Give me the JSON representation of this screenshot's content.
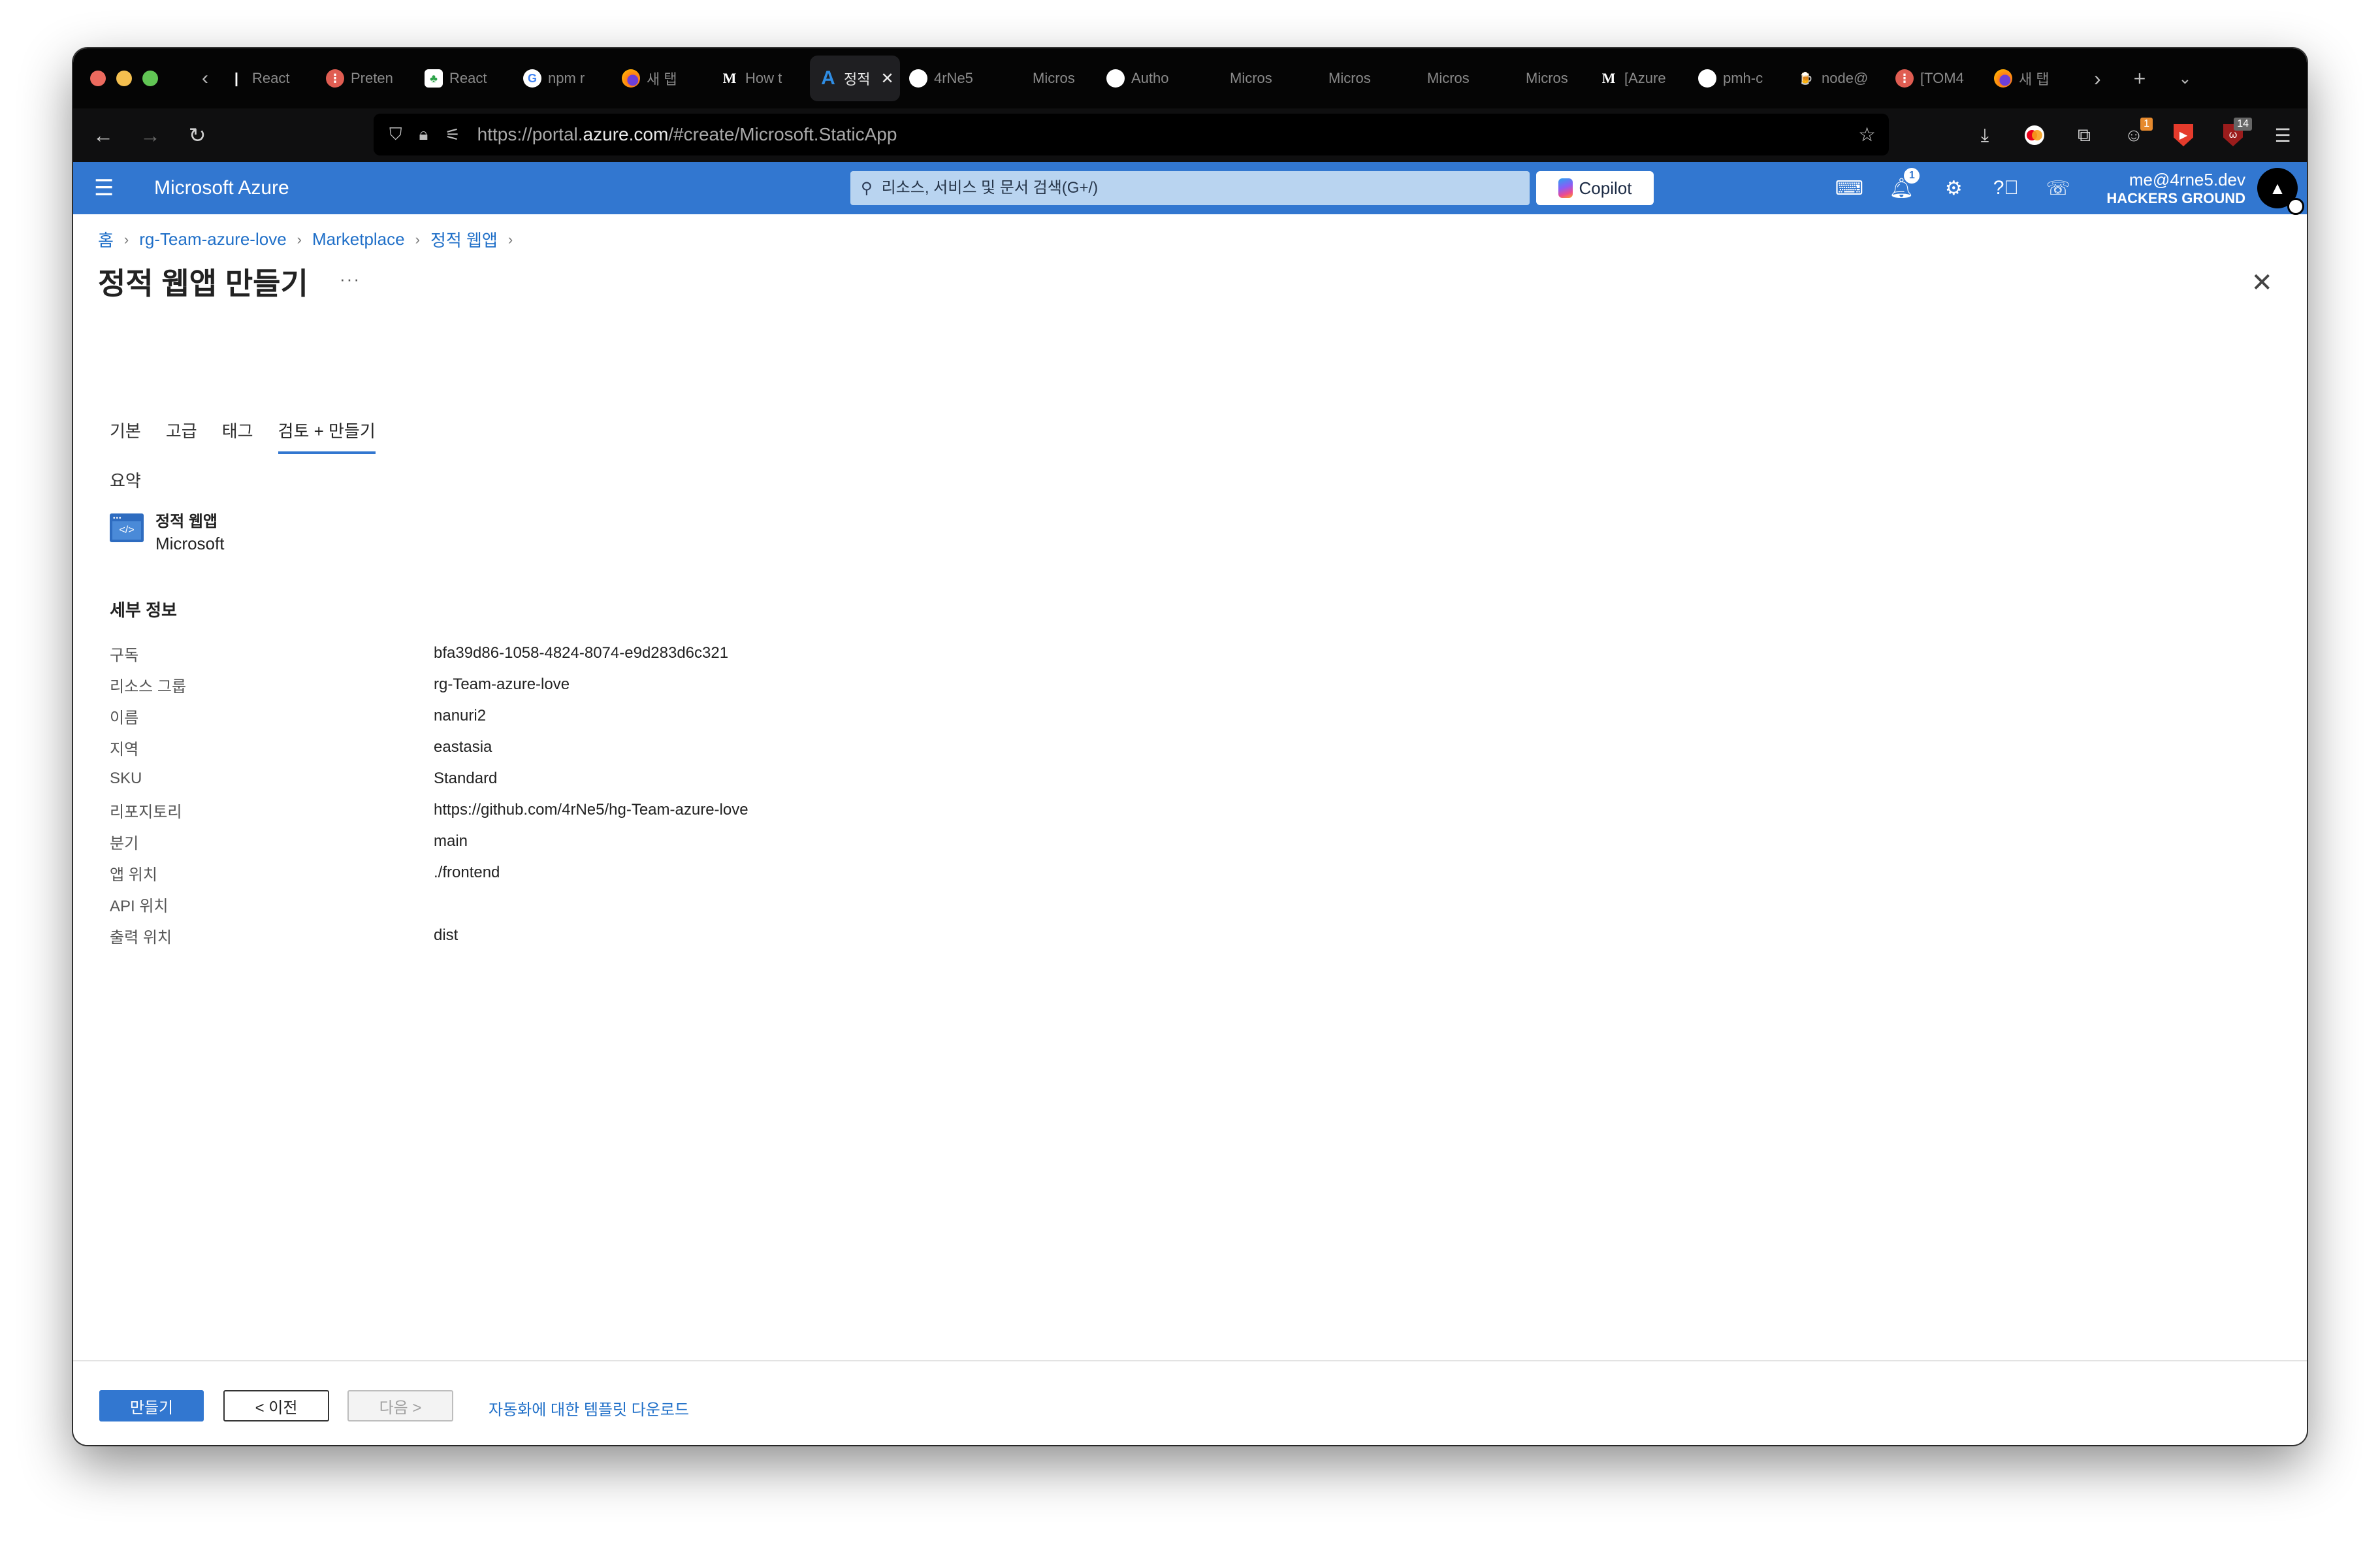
{
  "browser": {
    "tabs": [
      {
        "icon": "react-icon",
        "title": "React",
        "active": false
      },
      {
        "icon": "toggl-icon",
        "title": "Preten",
        "active": false
      },
      {
        "icon": "spring-icon",
        "title": "React",
        "active": false
      },
      {
        "icon": "google-icon",
        "title": "npm r",
        "active": false
      },
      {
        "icon": "firefox-icon",
        "title": "새 탭",
        "active": false
      },
      {
        "icon": "medium-icon",
        "title": "How t",
        "active": false
      },
      {
        "icon": "azure-icon",
        "title": "정적",
        "active": true
      },
      {
        "icon": "github-icon",
        "title": "4rNe5",
        "active": false
      },
      {
        "icon": "microsoft-icon",
        "title": "Micros",
        "active": false
      },
      {
        "icon": "github-icon",
        "title": "Autho",
        "active": false
      },
      {
        "icon": "microsoft-icon",
        "title": "Micros",
        "active": false
      },
      {
        "icon": "microsoft-icon",
        "title": "Micros",
        "active": false
      },
      {
        "icon": "microsoft-icon",
        "title": "Micros",
        "active": false
      },
      {
        "icon": "microsoft-icon",
        "title": "Micros",
        "active": false
      },
      {
        "icon": "medium-icon",
        "title": "[Azure",
        "active": false
      },
      {
        "icon": "github-icon",
        "title": "pmh-c",
        "active": false
      },
      {
        "icon": "homebrew-icon",
        "title": "node@",
        "active": false
      },
      {
        "icon": "toggl-icon",
        "title": "[TOM4",
        "active": false
      },
      {
        "icon": "firefox-icon",
        "title": "새 탭",
        "active": false
      }
    ],
    "url_prefix": "https://portal.",
    "url_domain": "azure.com",
    "url_path": "/#create/Microsoft.StaticApp",
    "extensions": {
      "badge_1": "1",
      "badge_2": "14"
    }
  },
  "azure_header": {
    "brand": "Microsoft Azure",
    "search_placeholder": "리소스, 서비스 및 문서 검색(G+/)",
    "copilot_label": "Copilot",
    "notification_count": "1",
    "account_email": "me@4rne5.dev",
    "account_org": "HACKERS GROUND",
    "avatar_initial": "▲"
  },
  "breadcrumb": [
    {
      "label": "홈"
    },
    {
      "label": "rg-Team-azure-love"
    },
    {
      "label": "Marketplace"
    },
    {
      "label": "정적 웹앱"
    }
  ],
  "page": {
    "title": "정적 웹앱 만들기",
    "more": "···"
  },
  "wizard_tabs": [
    {
      "label": "기본",
      "active": false
    },
    {
      "label": "고급",
      "active": false
    },
    {
      "label": "태그",
      "active": false
    },
    {
      "label": "검토 + 만들기",
      "active": true
    }
  ],
  "summary": {
    "label": "요약",
    "product_name": "정적 웹앱",
    "product_vendor": "Microsoft"
  },
  "details": {
    "title": "세부 정보",
    "rows": [
      {
        "label": "구독",
        "value": "bfa39d86-1058-4824-8074-e9d283d6c321"
      },
      {
        "label": "리소스 그룹",
        "value": "rg-Team-azure-love"
      },
      {
        "label": "이름",
        "value": "nanuri2"
      },
      {
        "label": "지역",
        "value": "eastasia"
      },
      {
        "label": "SKU",
        "value": "Standard"
      },
      {
        "label": "리포지토리",
        "value": "https://github.com/4rNe5/hg-Team-azure-love"
      },
      {
        "label": "분기",
        "value": "main"
      },
      {
        "label": "앱 위치",
        "value": "./frontend"
      },
      {
        "label": "API 위치",
        "value": ""
      },
      {
        "label": "출력 위치",
        "value": "dist"
      }
    ]
  },
  "footer": {
    "create_label": "만들기",
    "prev_label": "< 이전",
    "next_label": "다음 >",
    "download_link": "자동화에 대한 템플릿 다운로드"
  },
  "colors": {
    "azure_blue": "#3277d0",
    "link_blue": "#1f6fc8"
  }
}
